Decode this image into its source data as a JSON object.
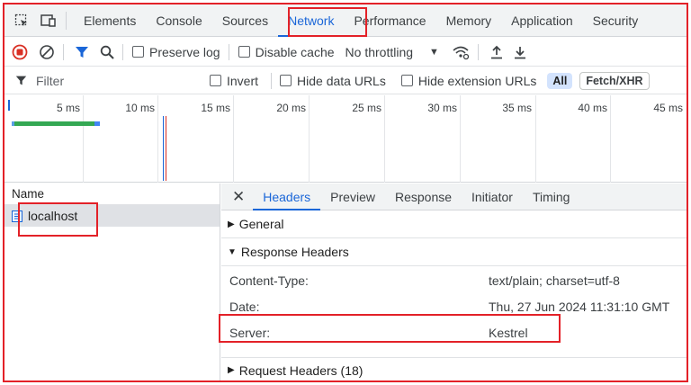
{
  "devtools": {
    "top_tabs": [
      "Elements",
      "Console",
      "Sources",
      "Network",
      "Performance",
      "Memory",
      "Application",
      "Security"
    ],
    "active_tab": "Network"
  },
  "toolbar": {
    "preserve_log_label": "Preserve log",
    "disable_cache_label": "Disable cache",
    "throttling_value": "No throttling"
  },
  "filterbar": {
    "filter_placeholder": "Filter",
    "invert_label": "Invert",
    "hide_data_urls_label": "Hide data URLs",
    "hide_extension_urls_label": "Hide extension URLs",
    "all_label": "All",
    "fetch_xhr_label": "Fetch/XHR"
  },
  "timeline": {
    "ticks": [
      "5 ms",
      "10 ms",
      "15 ms",
      "20 ms",
      "25 ms",
      "30 ms",
      "35 ms",
      "40 ms",
      "45 ms"
    ]
  },
  "requests": {
    "column_header": "Name",
    "items": [
      {
        "name": "localhost"
      }
    ]
  },
  "details": {
    "tabs": [
      "Headers",
      "Preview",
      "Response",
      "Initiator",
      "Timing"
    ],
    "active_tab": "Headers",
    "general_label": "General",
    "response_headers_label": "Response Headers",
    "response_headers": [
      {
        "key": "Content-Type:",
        "value": "text/plain; charset=utf-8"
      },
      {
        "key": "Date:",
        "value": "Thu, 27 Jun 2024 11:31:10 GMT"
      },
      {
        "key": "Server:",
        "value": "Kestrel"
      }
    ],
    "request_headers_label": "Request Headers (18)"
  },
  "colors": {
    "accent": "#1a66d8",
    "record": "#d93025",
    "annotation": "#e32128"
  }
}
